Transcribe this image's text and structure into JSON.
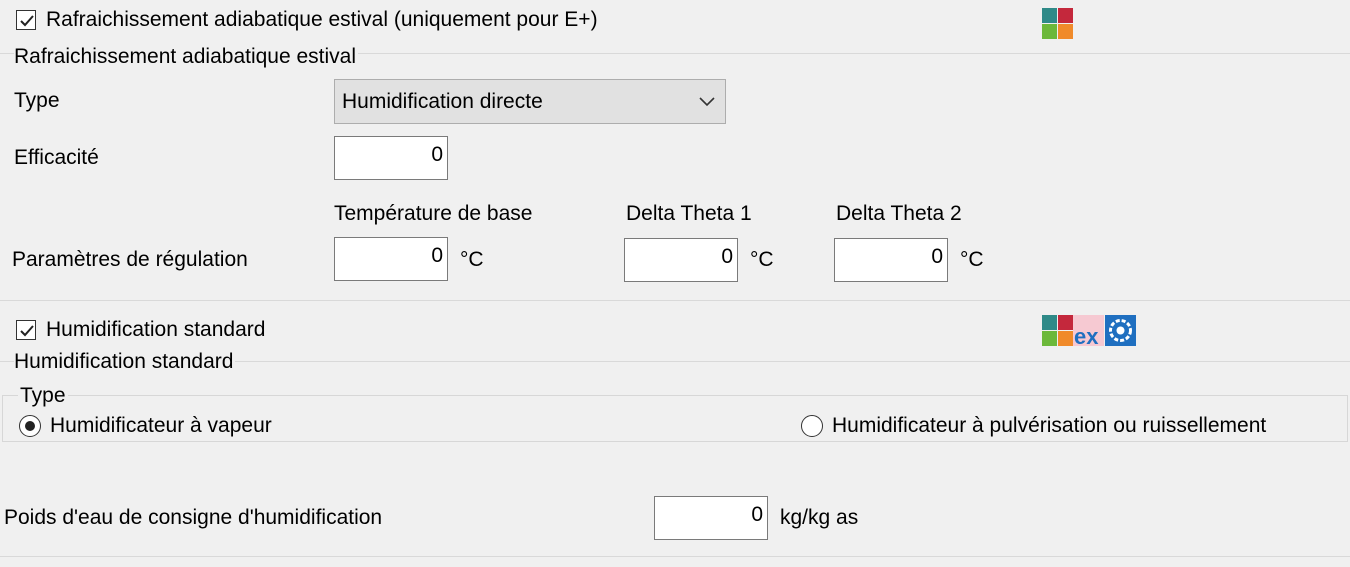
{
  "section1": {
    "checkbox_label": "Rafraichissement adiabatique estival (uniquement pour E+)",
    "checked": true,
    "group_title": "Rafraichissement adiabatique estival",
    "type_label": "Type",
    "type_value": "Humidification directe",
    "efficacite_label": "Efficacité",
    "efficacite_value": "0",
    "regulation_label": "Paramètres de régulation",
    "temp_base_label": "Température de base",
    "temp_base_value": "0",
    "temp_base_unit": "°C",
    "delta1_label": "Delta Theta 1",
    "delta1_value": "0",
    "delta1_unit": "°C",
    "delta2_label": "Delta Theta 2",
    "delta2_value": "0",
    "delta2_unit": "°C",
    "icons": [
      "energyplus-logo-icon"
    ]
  },
  "section2": {
    "checkbox_label": "Humidification standard",
    "checked": true,
    "group_title": "Humidification standard",
    "type_groupbox_label": "Type",
    "radio_options": [
      "Humidificateur à vapeur",
      "Humidificateur à pulvérisation ou ruissellement"
    ],
    "selected_option": "Humidificateur à vapeur",
    "poids_label": "Poids d'eau de consigne d'humidification",
    "poids_value": "0",
    "poids_unit": "kg/kg as",
    "icons": [
      "energyplus-logo-icon",
      "ex-logo-icon",
      "blue-gear-logo-icon"
    ]
  },
  "colors": {
    "background": "#f0f0f0",
    "separator": "#d9d9d9",
    "logo_blue": "#1f6fc0"
  }
}
